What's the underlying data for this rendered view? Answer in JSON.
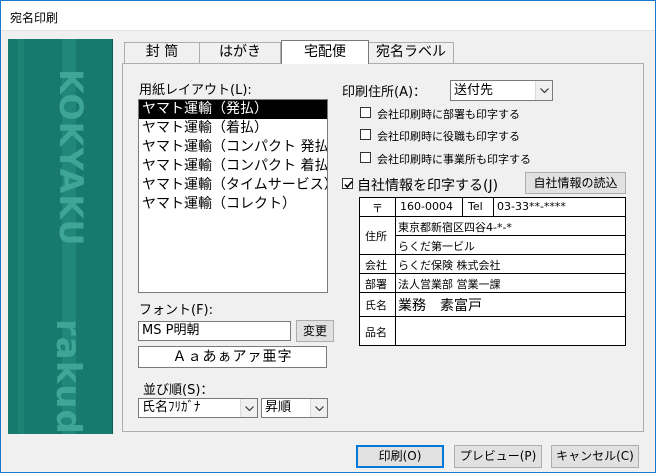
{
  "window": {
    "title": "宛名印刷"
  },
  "sidebar": {
    "watermark_top": "KOKYAKU",
    "watermark_bottom": "rakuda"
  },
  "tabs": [
    {
      "label": "封 筒"
    },
    {
      "label": "はがき"
    },
    {
      "label": "宅配便"
    },
    {
      "label": "宛名ラベル"
    }
  ],
  "layout_section": {
    "label": "用紙レイアウト(L):",
    "items": [
      {
        "label": "ヤマト運輸（発払）"
      },
      {
        "label": "ヤマト運輸（着払）"
      },
      {
        "label": "ヤマト運輸（コンパクト 発払）"
      },
      {
        "label": "ヤマト運輸（コンパクト 着払）"
      },
      {
        "label": "ヤマト運輸（タイムサービス）"
      },
      {
        "label": "ヤマト運輸（コレクト）"
      }
    ],
    "selected_index": 0
  },
  "font_section": {
    "label": "フォント(F):",
    "font_name": "MS P明朝",
    "change_button": "変更",
    "sample": "Ａａあぁアァ亜字"
  },
  "sort_section": {
    "label": "並び順(S)：",
    "sort_field": "氏名ﾌﾘｶﾞﾅ",
    "sort_order": "昇順"
  },
  "address_section": {
    "label": "印刷住所(A)：",
    "value": "送付先",
    "options": [
      {
        "label": "会社印刷時に部署も印字する",
        "checked": false
      },
      {
        "label": "会社印刷時に役職も印字する",
        "checked": false
      },
      {
        "label": "会社印刷時に事業所も印字する",
        "checked": false
      }
    ]
  },
  "self_info": {
    "checkbox_label": "自社情報を印字する(J)",
    "checked": true,
    "load_button": "自社情報の読込",
    "postal_mark": "〒",
    "postal_code": "160-0004",
    "tel_label": "Tel",
    "tel": "03-33**-****",
    "address_label": "住所",
    "address1": "東京都新宿区四谷4-*-*",
    "address2": "らくだ第一ビル",
    "company_label": "会社",
    "company": "らくだ保険 株式会社",
    "department_label": "部署",
    "department": "法人営業部 営業一課",
    "name_label": "氏名",
    "name": "業務　素富戸",
    "product_label": "品名",
    "product": ""
  },
  "footer": {
    "print_button": "印刷(O)",
    "preview_button": "プレビュー(P)",
    "cancel_button": "キャンセル(C)"
  },
  "colors": {
    "side_panel": "#187a6e",
    "focus_border": "#0078d7",
    "window_border": "#1979ca"
  }
}
